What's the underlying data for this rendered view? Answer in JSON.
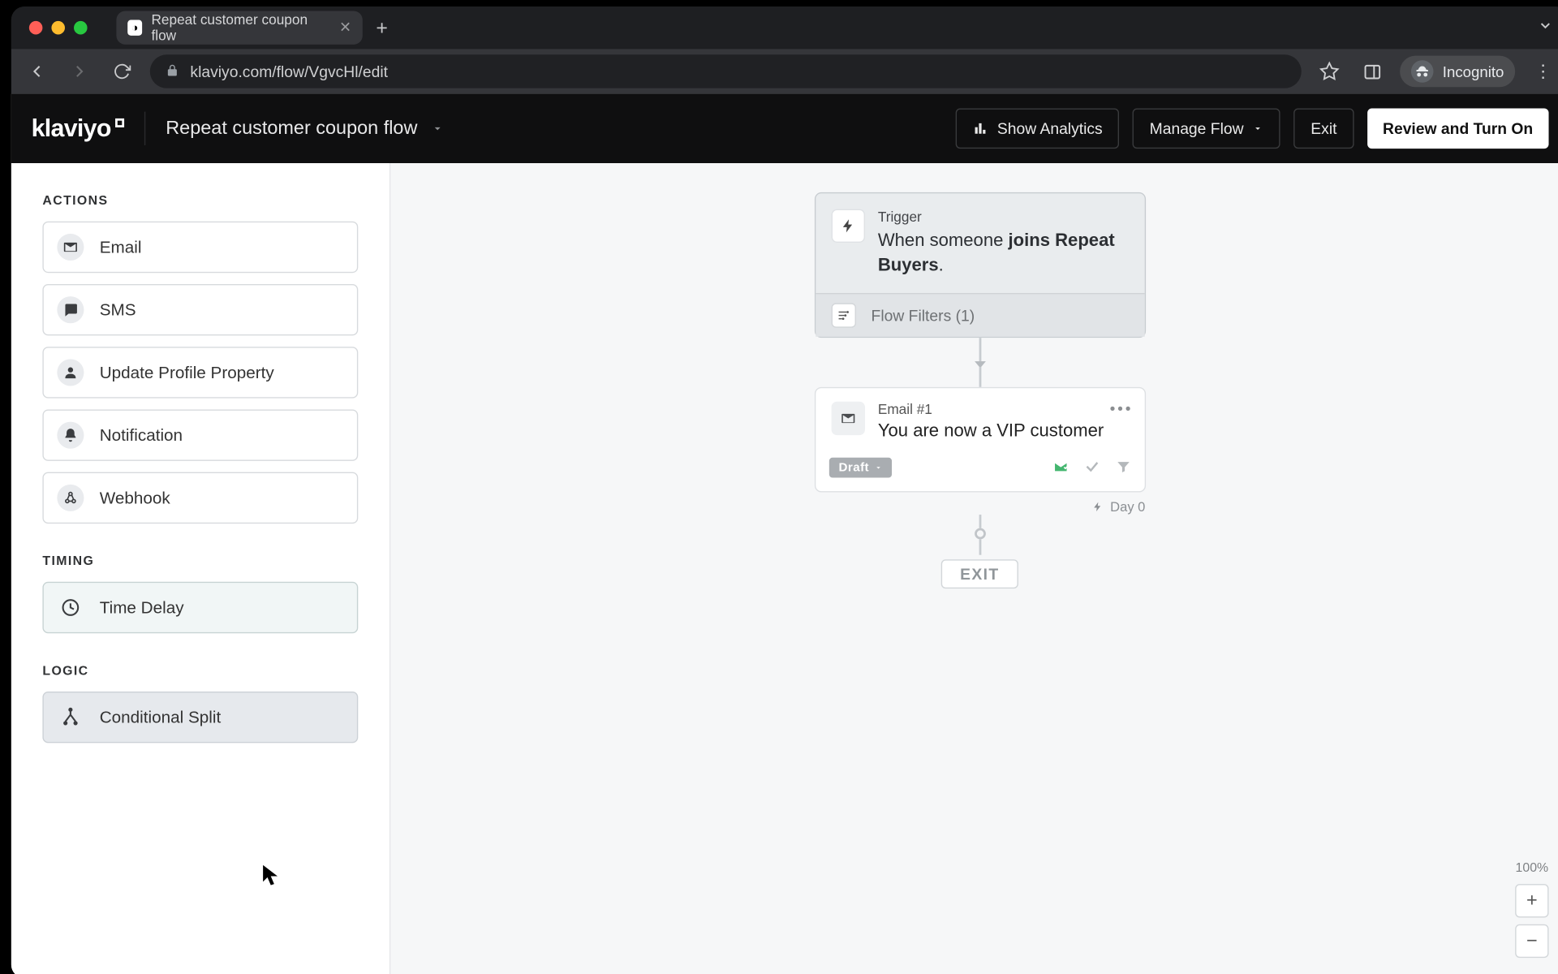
{
  "browser": {
    "tab_title": "Repeat customer coupon flow",
    "url": "klaviyo.com/flow/VgvcHl/edit",
    "incognito_label": "Incognito"
  },
  "header": {
    "logo_text": "klaviyo",
    "flow_name": "Repeat customer coupon flow",
    "show_analytics": "Show Analytics",
    "manage_flow": "Manage Flow",
    "exit_label": "Exit",
    "review_label": "Review and Turn On"
  },
  "sidebar": {
    "actions_head": "ACTIONS",
    "actions": [
      {
        "icon": "email-icon",
        "label": "Email"
      },
      {
        "icon": "sms-icon",
        "label": "SMS"
      },
      {
        "icon": "person-icon",
        "label": "Update Profile Property"
      },
      {
        "icon": "bell-icon",
        "label": "Notification"
      },
      {
        "icon": "webhook-icon",
        "label": "Webhook"
      }
    ],
    "timing_head": "TIMING",
    "timing": [
      {
        "icon": "clock-icon",
        "label": "Time Delay"
      }
    ],
    "logic_head": "LOGIC",
    "logic": [
      {
        "icon": "split-icon",
        "label": "Conditional Split"
      }
    ]
  },
  "canvas": {
    "trigger": {
      "label": "Trigger",
      "prefix": "When someone ",
      "bold": "joins Repeat Buyers",
      "suffix": ".",
      "filters_label": "Flow Filters (1)"
    },
    "email": {
      "label": "Email #1",
      "subject": "You are now a VIP customer",
      "status": "Draft"
    },
    "day_label": "Day 0",
    "exit_label": "EXIT",
    "zoom_pct": "100%"
  }
}
